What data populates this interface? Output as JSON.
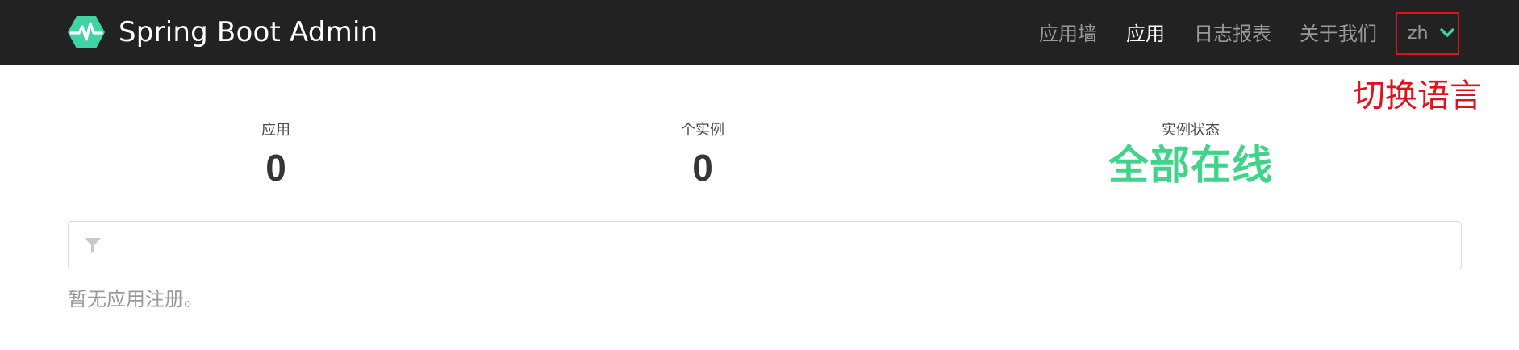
{
  "navbar": {
    "brand_title": "Spring Boot Admin",
    "logo_icon": "heartbeat-icon",
    "items": [
      {
        "label": "应用墙",
        "active": false
      },
      {
        "label": "应用",
        "active": true
      },
      {
        "label": "日志报表",
        "active": false
      },
      {
        "label": "关于我们",
        "active": false
      }
    ],
    "language": {
      "value": "zh",
      "icon": "chevron-down-icon"
    }
  },
  "annotation": {
    "text": "切换语言"
  },
  "stats": {
    "applications": {
      "label": "应用",
      "value": "0"
    },
    "instances": {
      "label": "个实例",
      "value": "0"
    },
    "status": {
      "label": "实例状态",
      "value": "全部在线"
    }
  },
  "filter": {
    "icon": "filter-icon",
    "value": "",
    "placeholder": ""
  },
  "empty_message": "暂无应用注册。",
  "colors": {
    "navbar_bg": "#222222",
    "brand_accent": "#42d3a5",
    "status_green": "#42d38a",
    "annotation_red": "#e0121b",
    "muted_text": "#9a9a9a"
  }
}
